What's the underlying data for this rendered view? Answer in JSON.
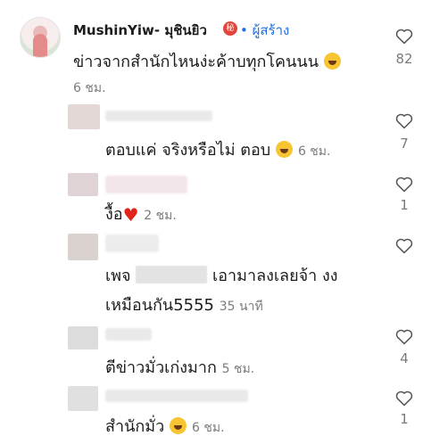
{
  "comment": {
    "username": "MushinYiw- มุชินยิว",
    "badge": "秘",
    "creator_label": "• ผู้สร้าง",
    "text": "ข่าวจากสำนักไหนง่ะค้าบทุกโคนนน",
    "time": "6 ชม.",
    "likes": "82"
  },
  "replies": [
    {
      "text": "ตอบแค่ จริงหรือไม่ ตอบ",
      "time": "6 ชม.",
      "likes": "7"
    },
    {
      "text": "งื้อ",
      "time": "2 ชม.",
      "likes": "1"
    },
    {
      "text_a": "เพจ",
      "text_b": "เอามาลงเลยจ้า งง",
      "text_c": "เหมือนกัน5555",
      "time": "35 นาที",
      "likes": ""
    },
    {
      "text": "ตีข่าวมั่วเก่งมาก",
      "time": "5 ชม.",
      "likes": "4"
    },
    {
      "text": "สำนักมั่ว",
      "time": "6 ชม.",
      "likes": "1"
    }
  ],
  "icons": {
    "like": "heart-outline-icon",
    "emoji_laugh": "laughing-emoji-icon",
    "red_heart": "red-heart-icon"
  },
  "colors": {
    "creator": "#1f6fe0",
    "badge": "#e0463c",
    "meta": "#7b7b7b"
  }
}
